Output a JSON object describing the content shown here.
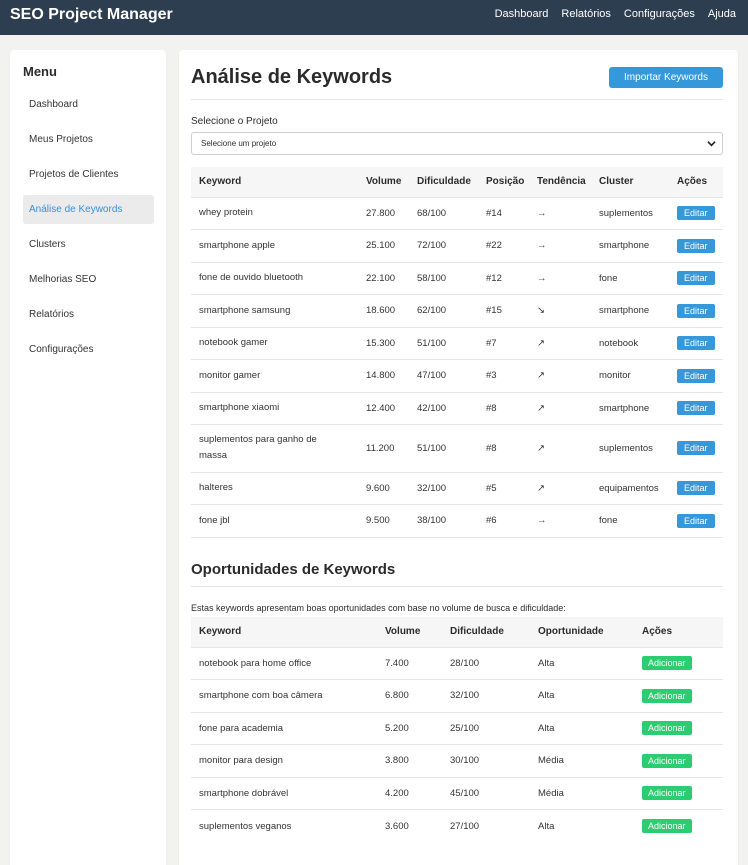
{
  "header": {
    "brand": "SEO Project Manager",
    "nav": [
      "Dashboard",
      "Relatórios",
      "Configurações",
      "Ajuda"
    ]
  },
  "sidebar": {
    "title": "Menu",
    "items": [
      {
        "label": "Dashboard"
      },
      {
        "label": "Meus Projetos"
      },
      {
        "label": "Projetos de Clientes"
      },
      {
        "label": "Análise de Keywords",
        "active": true
      },
      {
        "label": "Clusters"
      },
      {
        "label": "Melhorias SEO"
      },
      {
        "label": "Relatórios"
      },
      {
        "label": "Configurações"
      }
    ]
  },
  "main": {
    "title": "Análise de Keywords",
    "import_label": "Importar Keywords",
    "select_label": "Selecione o Projeto",
    "select_value": "Selecione um projeto",
    "keywords_table": {
      "headers": [
        "Keyword",
        "Volume",
        "Dificuldade",
        "Posição",
        "Tendência",
        "Cluster",
        "Ações"
      ],
      "rows": [
        {
          "keyword": "whey protein",
          "volume": "27.800",
          "difficulty": "68/100",
          "position": "#14",
          "trend": "→",
          "cluster": "suplementos",
          "action": "Editar"
        },
        {
          "keyword": "smartphone apple",
          "volume": "25.100",
          "difficulty": "72/100",
          "position": "#22",
          "trend": "→",
          "cluster": "smartphone",
          "action": "Editar"
        },
        {
          "keyword": "fone de ouvido bluetooth",
          "volume": "22.100",
          "difficulty": "58/100",
          "position": "#12",
          "trend": "→",
          "cluster": "fone",
          "action": "Editar"
        },
        {
          "keyword": "smartphone samsung",
          "volume": "18.600",
          "difficulty": "62/100",
          "position": "#15",
          "trend": "↘",
          "cluster": "smartphone",
          "action": "Editar"
        },
        {
          "keyword": "notebook gamer",
          "volume": "15.300",
          "difficulty": "51/100",
          "position": "#7",
          "trend": "↗",
          "cluster": "notebook",
          "action": "Editar"
        },
        {
          "keyword": "monitor gamer",
          "volume": "14.800",
          "difficulty": "47/100",
          "position": "#3",
          "trend": "↗",
          "cluster": "monitor",
          "action": "Editar"
        },
        {
          "keyword": "smartphone xiaomi",
          "volume": "12.400",
          "difficulty": "42/100",
          "position": "#8",
          "trend": "↗",
          "cluster": "smartphone",
          "action": "Editar"
        },
        {
          "keyword": "suplementos para ganho de massa",
          "volume": "11.200",
          "difficulty": "51/100",
          "position": "#8",
          "trend": "↗",
          "cluster": "suplementos",
          "action": "Editar"
        },
        {
          "keyword": "halteres",
          "volume": "9.600",
          "difficulty": "32/100",
          "position": "#5",
          "trend": "↗",
          "cluster": "equipamentos",
          "action": "Editar"
        },
        {
          "keyword": "fone jbl",
          "volume": "9.500",
          "difficulty": "38/100",
          "position": "#6",
          "trend": "→",
          "cluster": "fone",
          "action": "Editar"
        }
      ]
    },
    "opportunities": {
      "title": "Oportunidades de Keywords",
      "description": "Estas keywords apresentam boas oportunidades com base no volume de busca e dificuldade:",
      "headers": [
        "Keyword",
        "Volume",
        "Dificuldade",
        "Oportunidade",
        "Ações"
      ],
      "rows": [
        {
          "keyword": "notebook para home office",
          "volume": "7.400",
          "difficulty": "28/100",
          "opportunity": "Alta",
          "action": "Adicionar"
        },
        {
          "keyword": "smartphone com boa câmera",
          "volume": "6.800",
          "difficulty": "32/100",
          "opportunity": "Alta",
          "action": "Adicionar"
        },
        {
          "keyword": "fone para academia",
          "volume": "5.200",
          "difficulty": "25/100",
          "opportunity": "Alta",
          "action": "Adicionar"
        },
        {
          "keyword": "monitor para design",
          "volume": "3.800",
          "difficulty": "30/100",
          "opportunity": "Média",
          "action": "Adicionar"
        },
        {
          "keyword": "smartphone dobrável",
          "volume": "4.200",
          "difficulty": "45/100",
          "opportunity": "Média",
          "action": "Adicionar"
        },
        {
          "keyword": "suplementos veganos",
          "volume": "3.600",
          "difficulty": "27/100",
          "opportunity": "Alta",
          "action": "Adicionar"
        }
      ]
    }
  },
  "colors": {
    "header_bg": "#2c3e50",
    "primary": "#3498db",
    "success": "#2ecc71",
    "active_menu_text": "#3a8fd6"
  }
}
